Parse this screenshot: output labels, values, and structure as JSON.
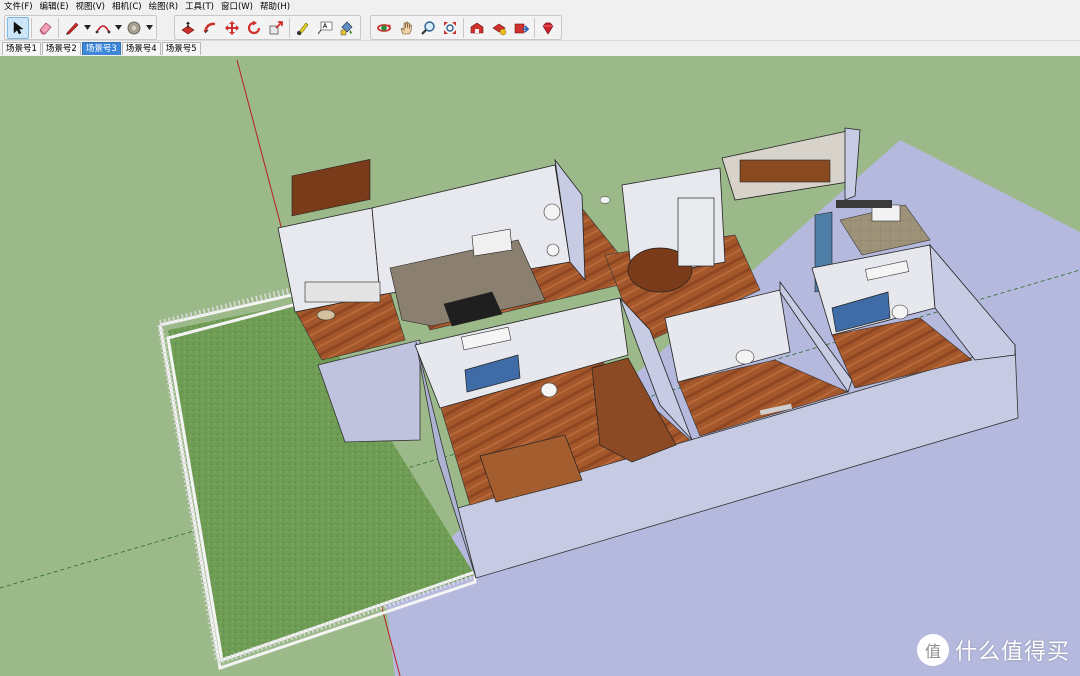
{
  "menu": {
    "items": [
      "文件(F)",
      "编辑(E)",
      "视图(V)",
      "相机(C)",
      "绘图(R)",
      "工具(T)",
      "窗口(W)",
      "帮助(H)"
    ]
  },
  "toolbar": {
    "tools": [
      {
        "name": "select-tool-icon",
        "active": true
      },
      {
        "name": "eraser-tool-icon"
      },
      {
        "name": "pencil-line-tool-icon"
      },
      {
        "name": "arc-tool-icon"
      },
      {
        "name": "paint-bucket-icon"
      },
      {
        "name": "push-pull-tool-icon"
      },
      {
        "name": "follow-me-tool-icon"
      },
      {
        "name": "move-tool-icon"
      },
      {
        "name": "rotate-tool-icon"
      },
      {
        "name": "scale-tool-icon"
      },
      {
        "name": "tape-measure-icon"
      },
      {
        "name": "text-tool-icon"
      },
      {
        "name": "paint-material-icon"
      },
      {
        "name": "orbit-tool-icon"
      },
      {
        "name": "pan-tool-icon"
      },
      {
        "name": "zoom-tool-icon"
      },
      {
        "name": "zoom-extents-icon"
      },
      {
        "name": "warehouse-icon"
      },
      {
        "name": "share-model-icon"
      },
      {
        "name": "extension-icon"
      },
      {
        "name": "ruby-icon"
      }
    ]
  },
  "scenes": {
    "tabs": [
      "场景号1",
      "场景号2",
      "场景号3",
      "场景号4",
      "场景号5"
    ],
    "active_index": 2
  },
  "watermark": {
    "text": "什么值得买",
    "logo_glyph": "值"
  },
  "colors": {
    "sky_ground": "#9cb98a",
    "lawn": "#6e9b54",
    "floor_wood": "#a0522d",
    "wall": "#e6e8ee",
    "wall_outer": "#c9cde3",
    "base_plane": "#b4b8dc",
    "active_tab": "#3d86d8"
  }
}
